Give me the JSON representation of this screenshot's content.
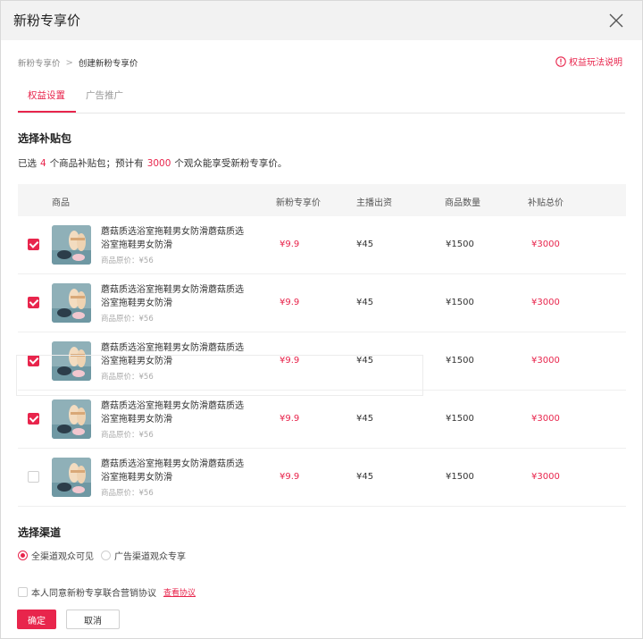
{
  "dialog": {
    "title": "新粉专享价"
  },
  "breadcrumb": {
    "items": [
      "新粉专享价",
      "创建新粉专享价"
    ],
    "separator": ">"
  },
  "rights_link": {
    "label": "权益玩法说明",
    "icon": "info-icon"
  },
  "tabs": [
    {
      "label": "权益设置",
      "active": true
    },
    {
      "label": "广告推广",
      "active": false
    }
  ],
  "section_subsidy": {
    "title": "选择补贴包",
    "summary_prefix": "已选",
    "selected_count": "4",
    "summary_middle": "个商品补贴包；预计有",
    "audience_count": "3000",
    "summary_suffix": "个观众能享受新粉专享价。"
  },
  "table": {
    "headers": {
      "product": "商品",
      "price": "新粉专享价",
      "host": "主播出资",
      "qty": "商品数量",
      "total": "补贴总价"
    },
    "rows": [
      {
        "checked": true,
        "name": "蘑菇质选浴室拖鞋男女防滑蘑菇质选浴室拖鞋男女防滑",
        "orig_price": "商品原价：¥56",
        "price": "¥9.9",
        "host": "¥45",
        "qty": "¥1500",
        "total": "¥3000"
      },
      {
        "checked": true,
        "name": "蘑菇质选浴室拖鞋男女防滑蘑菇质选浴室拖鞋男女防滑",
        "orig_price": "商品原价：¥56",
        "price": "¥9.9",
        "host": "¥45",
        "qty": "¥1500",
        "total": "¥3000"
      },
      {
        "checked": true,
        "name": "蘑菇质选浴室拖鞋男女防滑蘑菇质选浴室拖鞋男女防滑",
        "orig_price": "商品原价：¥56",
        "price": "¥9.9",
        "host": "¥45",
        "qty": "¥1500",
        "total": "¥3000"
      },
      {
        "checked": true,
        "name": "蘑菇质选浴室拖鞋男女防滑蘑菇质选浴室拖鞋男女防滑",
        "orig_price": "商品原价：¥56",
        "price": "¥9.9",
        "host": "¥45",
        "qty": "¥1500",
        "total": "¥3000"
      },
      {
        "checked": false,
        "name": "蘑菇质选浴室拖鞋男女防滑蘑菇质选浴室拖鞋男女防滑",
        "orig_price": "商品原价：¥56",
        "price": "¥9.9",
        "host": "¥45",
        "qty": "¥1500",
        "total": "¥3000"
      }
    ]
  },
  "section_channel": {
    "title": "选择渠道",
    "options": [
      {
        "label": "全渠道观众可见",
        "selected": true
      },
      {
        "label": "广告渠道观众专享",
        "selected": false
      }
    ]
  },
  "agreement": {
    "label": "本人同意新粉专享联合营销协议",
    "link": "查看协议",
    "checked": false
  },
  "buttons": {
    "ok": "确定",
    "cancel": "取消"
  },
  "colors": {
    "accent": "#e8254c",
    "header_bg": "#f2f2f2",
    "table_head_bg": "#f5f5f5"
  }
}
